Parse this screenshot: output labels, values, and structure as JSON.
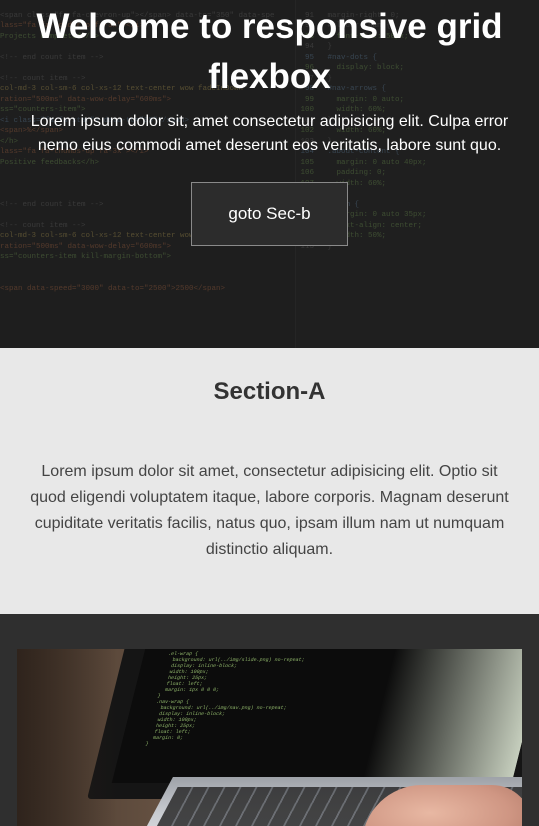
{
  "hero": {
    "title": "Welcome to responsive grid flexbox",
    "text": "Lorem ipsum dolor sit, amet consectetur adipisicing elit. Culpa error nemo eius commodi amet deserunt eos veritatis, labore sunt quo.",
    "button_label": "goto Sec-b"
  },
  "section_a": {
    "heading": "Section-A",
    "text": "Lorem ipsum dolor sit amet, consectetur adipisicing elit. Optio sit quod eligendi voluptatem itaque, labore corporis. Magnam deserunt cupiditate veritatis facilis, natus quo, ipsam illum nam ut numquam distinctio aliquam."
  },
  "section_b": {
    "image_alt_icon": "laptop-photo"
  },
  "colors": {
    "hero_bg": "#232323",
    "section_a_bg": "#e8e8e8",
    "section_b_bg": "#2f2f2f",
    "heading_text": "#333333"
  }
}
